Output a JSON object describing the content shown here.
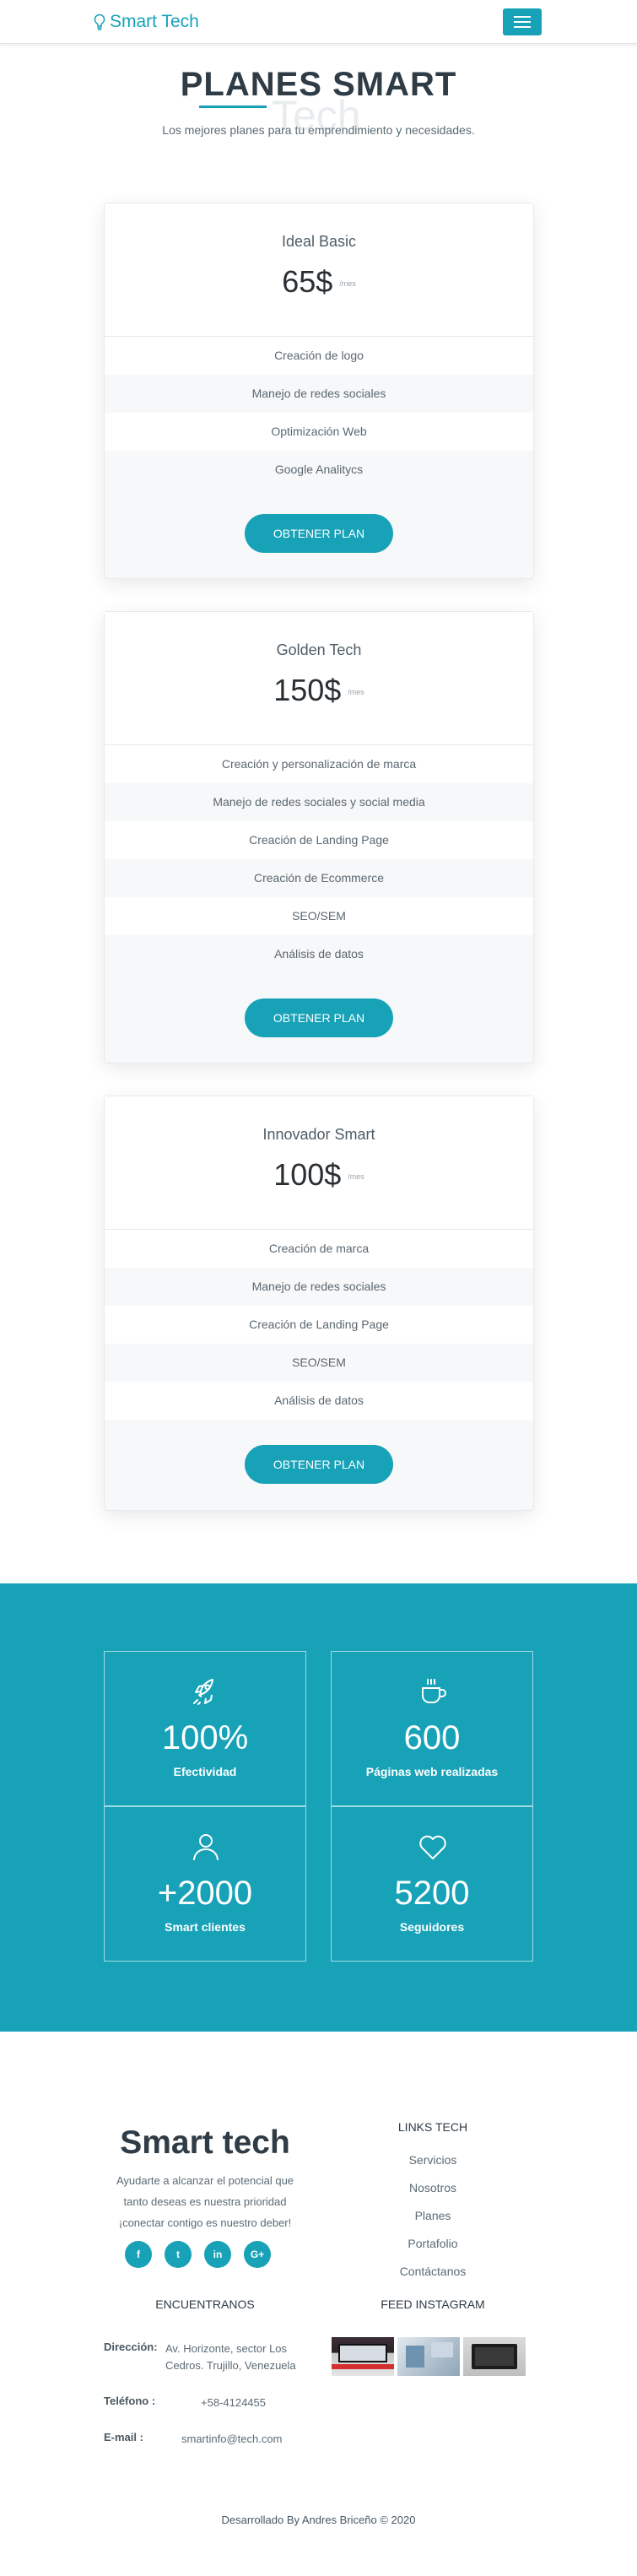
{
  "navbar": {
    "brand": "Smart Tech",
    "accent": "#17a2b8"
  },
  "plans_section": {
    "title": "PLANES SMART",
    "ghost_text": "Tech",
    "subtitle": "Los mejores planes para tu emprendimiento y necesidades."
  },
  "plans": [
    {
      "name": "Ideal Basic",
      "price": "65$",
      "period": "/mes",
      "features": [
        "Creación de logo",
        "Manejo de redes sociales",
        "Optimización Web",
        "Google Analitycs"
      ],
      "button": "OBTENER PLAN"
    },
    {
      "name": "Golden Tech",
      "price": "150$",
      "period": "/mes",
      "features": [
        "Creación y personalización de marca",
        "Manejo de redes sociales y social media",
        "Creación de Landing Page",
        "Creación de Ecommerce",
        "SEO/SEM",
        "Análisis de datos"
      ],
      "button": "OBTENER PLAN"
    },
    {
      "name": "Innovador Smart",
      "price": "100$",
      "period": "/mes",
      "features": [
        "Creación de marca",
        "Manejo de redes sociales",
        "Creación de Landing Page",
        "SEO/SEM",
        "Análisis de datos"
      ],
      "button": "OBTENER PLAN"
    }
  ],
  "stats": [
    {
      "icon": "rocket-icon",
      "value": "100%",
      "label": "Efectividad"
    },
    {
      "icon": "coffee-icon",
      "value": "600",
      "label": "Páginas web realizadas"
    },
    {
      "icon": "user-icon",
      "value": "+2000",
      "label": "Smart clientes"
    },
    {
      "icon": "heart-icon",
      "value": "5200",
      "label": "Seguidores"
    }
  ],
  "footer": {
    "brand": "Smart tech",
    "description_lines": [
      "Ayudarte a alcanzar el potencial que",
      "tanto deseas es nuestra prioridad",
      "¡conectar contigo es nuestro deber!"
    ],
    "socials": [
      {
        "icon": "facebook-icon",
        "glyph": "f"
      },
      {
        "icon": "twitter-icon",
        "glyph": "t"
      },
      {
        "icon": "linkedin-icon",
        "glyph": "in"
      },
      {
        "icon": "google-plus-icon",
        "glyph": "G+"
      }
    ],
    "links_title": "LINKS TECH",
    "links": [
      "Servicios",
      "Nosotros",
      "Planes",
      "Portafolio",
      "Contáctanos"
    ],
    "find_us_title": "ENCUENTRANOS",
    "address_label": "Dirección:",
    "address_value": "Av. Horizonte, sector Los Cedros. Trujillo, Venezuela",
    "phone_label": "Teléfono :",
    "phone_value": "+58-4124455",
    "email_label": "E-mail :",
    "email_value": "smartinfo@tech.com",
    "instagram_title": "FEED INSTAGRAM",
    "credit": "Desarrollado By Andres Briceño © 2020"
  }
}
